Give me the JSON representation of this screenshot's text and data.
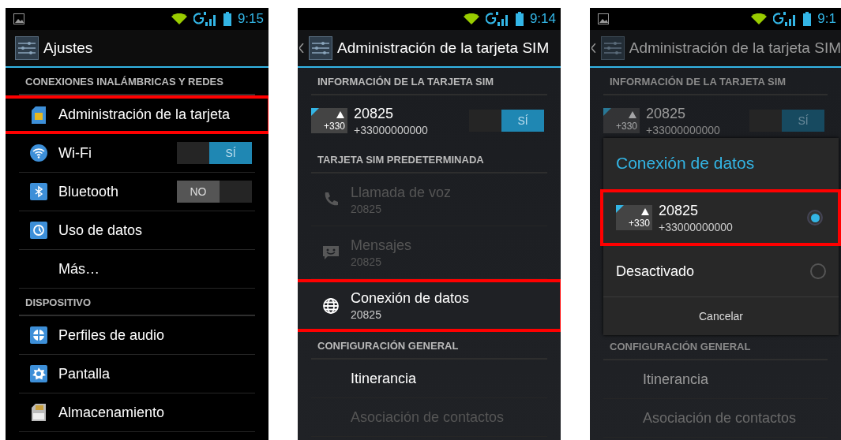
{
  "phones": [
    {
      "status_bar": {
        "notification_icon": true,
        "time": "9:15"
      },
      "action_bar": {
        "back": false,
        "title": "Ajustes"
      },
      "dimmed": false,
      "sections": [
        {
          "header": "CONEXIONES INALÁMBRICAS Y REDES",
          "items": [
            {
              "kind": "plain",
              "title": "Administración de la tarjeta",
              "highlighted": true
            },
            {
              "kind": "toggle",
              "title": "Wi-Fi",
              "on": true,
              "toggle_label": "SÍ",
              "highlighted": false
            },
            {
              "kind": "toggle",
              "title": "Bluetooth",
              "on": false,
              "toggle_label": "NO",
              "highlighted": false
            },
            {
              "kind": "plain",
              "title": "Uso de datos",
              "highlighted": false
            },
            {
              "kind": "plain",
              "title": "Más…",
              "highlighted": false
            }
          ]
        },
        {
          "header": "DISPOSITIVO",
          "items": [
            {
              "kind": "plain",
              "title": "Perfiles de audio",
              "highlighted": false
            },
            {
              "kind": "plain",
              "title": "Pantalla",
              "highlighted": false
            },
            {
              "kind": "plain",
              "title": "Almacenamiento",
              "highlighted": false
            }
          ]
        }
      ]
    },
    {
      "status_bar": {
        "notification_icon": false,
        "time": "9:14"
      },
      "action_bar": {
        "back": true,
        "title": "Administración de la tarjeta SIM"
      },
      "dimmed": false,
      "sections": [
        {
          "header": "INFORMACIÓN DE LA TARJETA SIM",
          "items": [
            {
              "kind": "sim",
              "title": "20825",
              "subtitle": "+33000000000",
              "badge": "+330",
              "on": true,
              "toggle_label": "SÍ",
              "highlighted": false
            }
          ]
        },
        {
          "header": "TARJETA SIM PREDETERMINADA",
          "items": [
            {
              "kind": "subtitle",
              "title": "Llamada de voz",
              "subtitle": "20825",
              "disabled": true,
              "highlighted": false
            },
            {
              "kind": "subtitle",
              "title": "Mensajes",
              "subtitle": "20825",
              "disabled": true,
              "highlighted": false
            },
            {
              "kind": "subtitle",
              "title": "Conexión de datos",
              "subtitle": "20825",
              "disabled": false,
              "highlighted": true
            }
          ]
        },
        {
          "header": "CONFIGURACIÓN GENERAL",
          "items": [
            {
              "kind": "plain",
              "title": "Itinerancia",
              "disabled": false,
              "highlighted": false
            },
            {
              "kind": "plain",
              "title": "Asociación de contactos",
              "disabled": true,
              "highlighted": false
            }
          ]
        }
      ]
    },
    {
      "status_bar": {
        "notification_icon": true,
        "time": "9:1"
      },
      "action_bar": {
        "back": true,
        "title": "Administración de la tarjeta SIM"
      },
      "dimmed": true,
      "sections": [
        {
          "header": "INFORMACIÓN DE LA TARJETA SIM",
          "items": [
            {
              "kind": "sim",
              "title": "20825",
              "subtitle": "+33000000000",
              "badge": "+330",
              "on": true,
              "toggle_label": "SÍ",
              "highlighted": false
            }
          ]
        },
        {
          "header": "CONFIGURACIÓN GENERAL",
          "items": [
            {
              "kind": "plain",
              "title": "Itinerancia",
              "disabled": false,
              "highlighted": false
            },
            {
              "kind": "plain",
              "title": "Asociación de contactos",
              "disabled": true,
              "highlighted": false
            }
          ]
        }
      ],
      "dialog": {
        "title": "Conexión de datos",
        "options": [
          {
            "kind": "sim",
            "title": "20825",
            "subtitle": "+33000000000",
            "badge": "+330",
            "selected": true,
            "highlighted": true
          },
          {
            "kind": "plain",
            "title": "Desactivado",
            "selected": false,
            "highlighted": false
          }
        ],
        "button": "Cancelar"
      }
    }
  ]
}
